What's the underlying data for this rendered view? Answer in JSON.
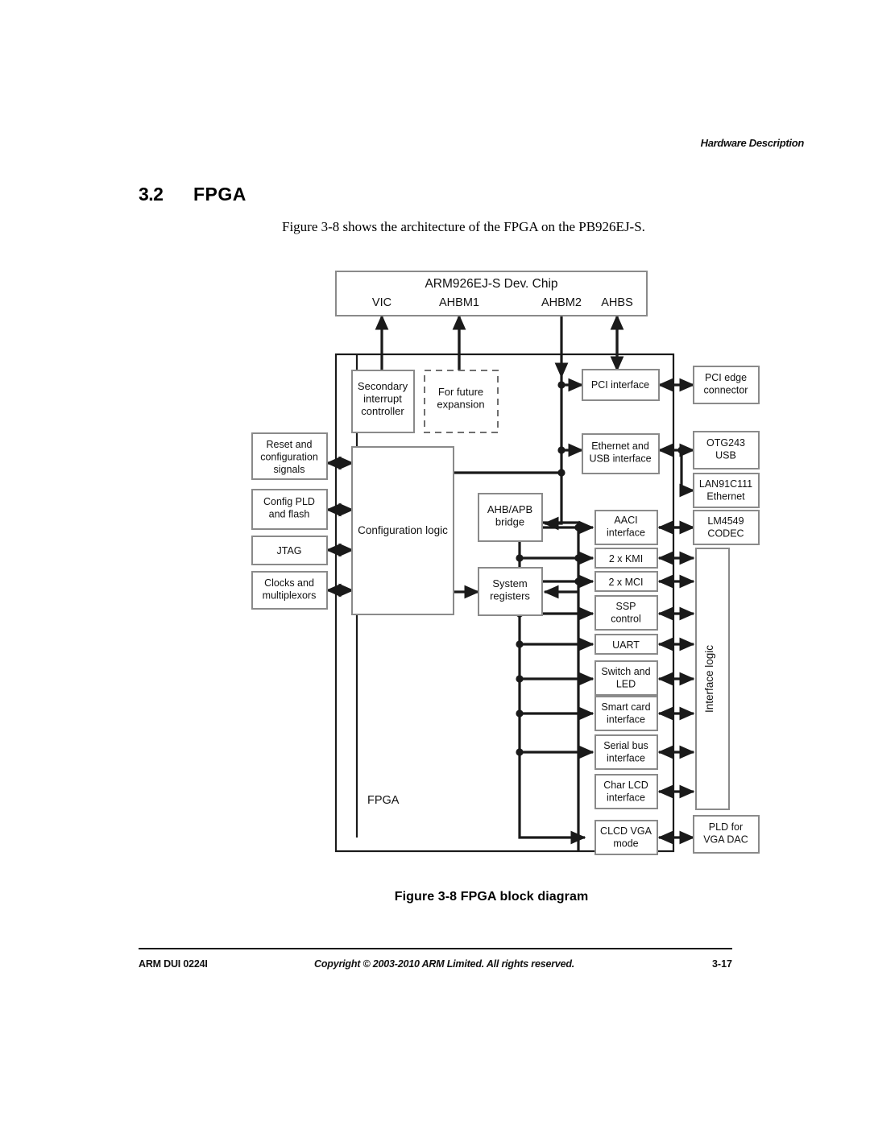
{
  "header": {
    "running_head": "Hardware Description"
  },
  "section": {
    "number": "3.2",
    "title": "FPGA",
    "intro": "Figure 3-8 shows the architecture of the FPGA on the PB926EJ-S."
  },
  "figure": {
    "caption": "Figure 3-8 FPGA block diagram",
    "fpga_label": "FPGA"
  },
  "footer": {
    "doc_id": "ARM DUI 0224I",
    "copyright": "Copyright © 2003-2010 ARM Limited. All rights reserved.",
    "page": "3-17"
  },
  "diagram": {
    "dev_chip": {
      "title": "ARM926EJ-S Dev. Chip",
      "ports": [
        "VIC",
        "AHBM1",
        "AHBM2",
        "AHBS"
      ]
    },
    "fpga_internal": {
      "secondary_interrupt_controller": "Secondary\ninterrupt\ncontroller",
      "future_expansion": "For future\nexpansion",
      "configuration_logic": "Configuration logic",
      "ahb_apb_bridge": "AHB/APB\nbridge",
      "system_registers": "System\nregisters",
      "interface_logic": "Interface logic"
    },
    "left_blocks": [
      {
        "id": "reset-and-configuration-signals",
        "label": "Reset and\nconfiguration\nsignals"
      },
      {
        "id": "config-pld-and-flash",
        "label": "Config PLD\nand flash"
      },
      {
        "id": "jtag",
        "label": "JTAG"
      },
      {
        "id": "clocks-and-multiplexors",
        "label": "Clocks and\nmultiplexors"
      }
    ],
    "ahb_peripherals": [
      {
        "id": "pci-interface",
        "label": "PCI interface"
      },
      {
        "id": "ethernet-and-usb-interface",
        "label": "Ethernet and\nUSB interface"
      }
    ],
    "apb_peripherals": [
      {
        "id": "aaci-interface",
        "label": "AACI\ninterface"
      },
      {
        "id": "kmi",
        "label": "2 x KMI"
      },
      {
        "id": "mci",
        "label": "2 x MCI"
      },
      {
        "id": "ssp-control",
        "label": "SSP\ncontrol"
      },
      {
        "id": "uart",
        "label": "UART"
      },
      {
        "id": "switch-and-led",
        "label": "Switch and\nLED"
      },
      {
        "id": "smart-card-interface",
        "label": "Smart card\ninterface"
      },
      {
        "id": "serial-bus-interface",
        "label": "Serial bus\ninterface"
      },
      {
        "id": "char-lcd-interface",
        "label": "Char LCD\ninterface"
      },
      {
        "id": "clcd-vga-mode",
        "label": "CLCD VGA\nmode"
      }
    ],
    "external_devices": [
      {
        "id": "pci-edge-connector",
        "label": "PCI edge\nconnector"
      },
      {
        "id": "otg243-usb",
        "label": "OTG243\nUSB"
      },
      {
        "id": "lan91c111-ethernet",
        "label": "LAN91C111\nEthernet"
      },
      {
        "id": "lm4549-codec",
        "label": "LM4549\nCODEC"
      },
      {
        "id": "pld-for-vga-dac",
        "label": "PLD for\nVGA DAC"
      }
    ],
    "colors": {
      "line": "#1a1a1a",
      "box_stroke": "#8a8a8a",
      "box_fill": "#ffffff",
      "dashed_stroke": "#6f6f6f",
      "text": "#111111"
    }
  }
}
